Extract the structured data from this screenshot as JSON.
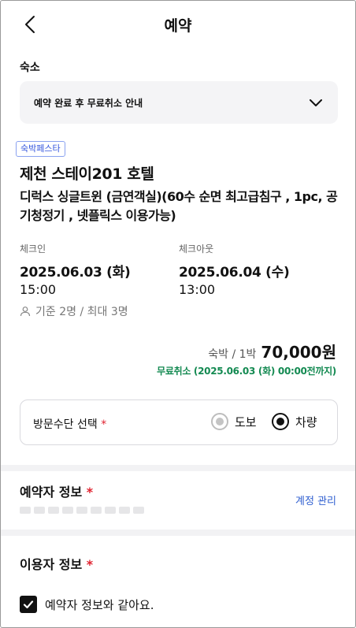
{
  "header": {
    "title": "예약"
  },
  "lodging_section": {
    "label": "숙소",
    "notice": "예약 완료 후 무료취소 안내"
  },
  "hotel": {
    "badge": "숙박페스타",
    "name": "제천 스테이201 호텔",
    "room": "디럭스 싱글트윈 (금연객실)(60수 순면 최고급침구 , 1pc, 공기청정기 , 넷플릭스 이용가능)"
  },
  "stay": {
    "checkin": {
      "label": "체크인",
      "date": "2025.06.03 (화)",
      "time": "15:00"
    },
    "checkout": {
      "label": "체크아웃",
      "date": "2025.06.04 (수)",
      "time": "13:00"
    },
    "capacity": "기준 2명 / 최대 3명"
  },
  "price": {
    "unit": "숙박 / 1박",
    "amount": "70,000원",
    "cancel": "무료취소 (2025.06.03 (화) 00:00전까지)"
  },
  "visit": {
    "label": "방문수단 선택",
    "required_mark": "*",
    "options": [
      {
        "label": "도보",
        "selected": false
      },
      {
        "label": "차량",
        "selected": true
      }
    ]
  },
  "booker": {
    "title": "예약자 정보",
    "required_mark": "*",
    "account_link": "계정 관리"
  },
  "user_info": {
    "title": "이용자 정보",
    "required_mark": "*",
    "same_as_booker": "예약자 정보와 같아요.",
    "same_checked": true
  },
  "colors": {
    "accent_link": "#2f5fd0",
    "cancel_green": "#148a52",
    "required_red": "#e0222f",
    "badge_blue": "#3355dd"
  }
}
